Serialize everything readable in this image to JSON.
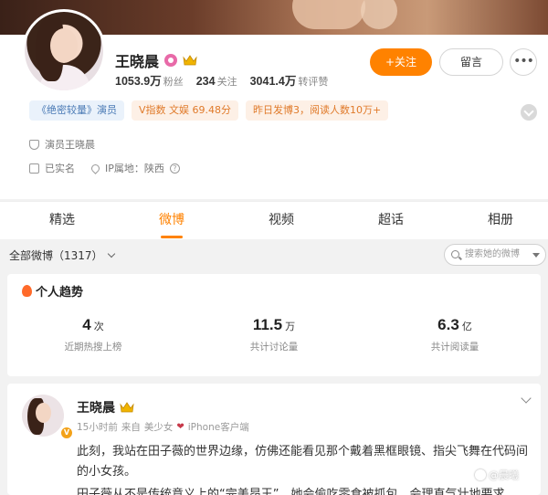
{
  "profile": {
    "name": "王晓晨",
    "fans_count": "1053.9万",
    "fans_label": "粉丝",
    "following_count": "234",
    "following_label": "关注",
    "reposts_count": "3041.4万",
    "reposts_label": "转评赞",
    "follow_button": "+关注",
    "message_button": "留言",
    "more_button": "•••",
    "tags": [
      "《绝密较量》演员",
      "V指数 文娱 69.48分",
      "昨日发博3，阅读人数10万+"
    ],
    "cert": "演员王晓晨",
    "realname": "已实名",
    "ip": "IP属地：陕西",
    "ip_help": "?",
    "verified_badge": "V"
  },
  "tabs": [
    "精选",
    "微博",
    "视频",
    "超话",
    "相册"
  ],
  "active_tab": "微博",
  "filter": {
    "all_posts": "全部微博（1317）",
    "search_placeholder": "搜索她的微博"
  },
  "trend": {
    "title": "个人趋势",
    "items": [
      {
        "value": "4",
        "unit": "次",
        "label": "近期热搜上榜"
      },
      {
        "value": "11.5",
        "unit": "万",
        "label": "共计讨论量"
      },
      {
        "value": "6.3",
        "unit": "亿",
        "label": "共计阅读量"
      }
    ]
  },
  "post": {
    "name": "王晓晨",
    "time": "15小时前",
    "from": "来自",
    "source": "美少女",
    "client": "iPhone客户端",
    "heart": "❤",
    "verified_badge": "V",
    "text": "此刻，我站在田子薇的世界边缘，仿佛还能看见那个戴着黑框眼镜、指尖飞舞在代码间的小女孩。",
    "text_faded": "田子薇从不是传统意义上的“完美昂王”，她会偷吃零食被抓包，会理直气壮地要求"
  },
  "watermark": "@晨曦",
  "colors": {
    "accent": "#ff8200",
    "tag_blue": "#4a7ab5",
    "tag_orange": "#e07a2a"
  }
}
